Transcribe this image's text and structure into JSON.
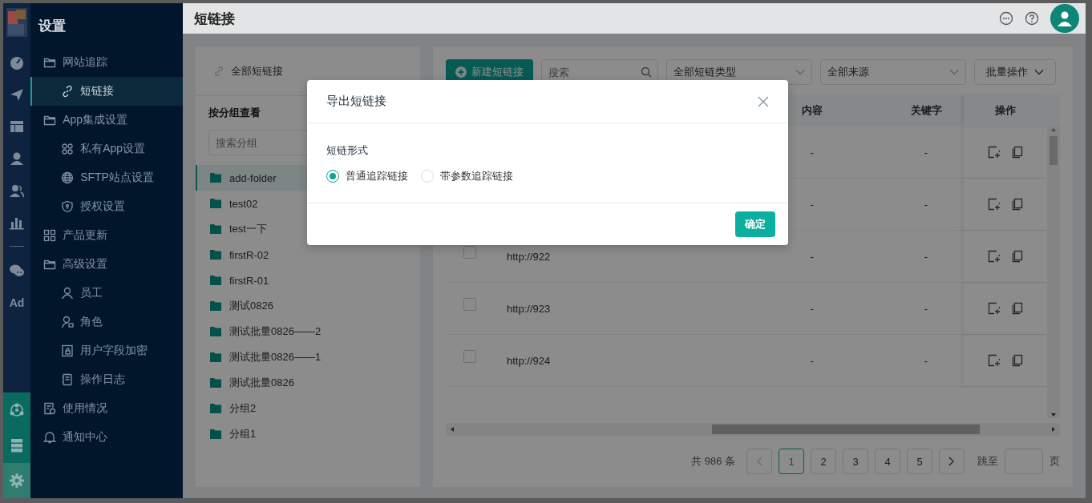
{
  "rail": {
    "items": [
      {
        "kind": "icon",
        "selected": false
      },
      {
        "kind": "icon",
        "selected": false
      },
      {
        "kind": "icon",
        "selected": false
      },
      {
        "kind": "icon",
        "selected": false
      },
      {
        "kind": "icon",
        "selected": false
      },
      {
        "kind": "icon",
        "selected": false
      },
      {
        "kind": "divider"
      },
      {
        "kind": "icon",
        "selected": false
      },
      {
        "kind": "text",
        "label": "Ad",
        "selected": false
      }
    ],
    "bottom_items": [
      {
        "selected": false
      },
      {
        "selected": false
      },
      {
        "selected": true
      }
    ]
  },
  "sidebar": {
    "title": "设置",
    "items": [
      {
        "label": "网站追踪",
        "selected": false,
        "children": [
          {
            "label": "短链接",
            "selected": true
          }
        ]
      },
      {
        "label": "App集成设置",
        "selected": false,
        "children": [
          {
            "label": "私有App设置",
            "selected": false
          },
          {
            "label": "SFTP站点设置",
            "selected": false
          },
          {
            "label": "授权设置",
            "selected": false
          }
        ]
      },
      {
        "label": "产品更新",
        "selected": false
      },
      {
        "label": "高级设置",
        "selected": false,
        "children": [
          {
            "label": "员工",
            "selected": false
          },
          {
            "label": "角色",
            "selected": false
          },
          {
            "label": "用户字段加密",
            "selected": false
          },
          {
            "label": "操作日志",
            "selected": false
          }
        ]
      },
      {
        "label": "使用情况",
        "selected": false
      },
      {
        "label": "通知中心",
        "selected": false
      }
    ]
  },
  "header": {
    "title": "短链接"
  },
  "groups": {
    "all_label": "全部短链接",
    "heading": "按分组查看",
    "search": {
      "placeholder": "搜索分组"
    },
    "items": [
      {
        "label": "add-folder",
        "selected": true
      },
      {
        "label": "test02",
        "selected": false
      },
      {
        "label": "test一下",
        "selected": false
      },
      {
        "label": "firstR-02",
        "selected": false
      },
      {
        "label": "firstR-01",
        "selected": false
      },
      {
        "label": "测试0826",
        "selected": false
      },
      {
        "label": "测试批量0826——2",
        "selected": false
      },
      {
        "label": "测试批量0826——1",
        "selected": false
      },
      {
        "label": "测试批量0826",
        "selected": false
      },
      {
        "label": "分组2",
        "selected": false
      },
      {
        "label": "分组1",
        "selected": false
      }
    ]
  },
  "toolbar": {
    "new_button": "新建短链接",
    "search": {
      "placeholder": "搜索"
    },
    "type_select": "全部短链类型",
    "source_select": "全部来源",
    "batch_button": "批量操作"
  },
  "table": {
    "columns": [
      {
        "label": "内容"
      },
      {
        "label": "关键字"
      },
      {
        "label": "操作"
      }
    ],
    "rows": [
      {
        "content": "-",
        "keyword": "-"
      },
      {
        "content": "-",
        "keyword": "-"
      },
      {
        "checked": false,
        "link": "http://922",
        "content": "-",
        "keyword": "-"
      },
      {
        "checked": false,
        "link": "http://923",
        "content": "-",
        "keyword": "-"
      },
      {
        "checked": false,
        "link": "http://924",
        "content": "-",
        "keyword": "-"
      }
    ]
  },
  "pagination": {
    "total": "共 986 条",
    "prev_disabled": true,
    "next_disabled": false,
    "pages": [
      {
        "label": "1",
        "selected": true
      },
      {
        "label": "2",
        "selected": false
      },
      {
        "label": "3",
        "selected": false
      },
      {
        "label": "4",
        "selected": false
      },
      {
        "label": "5",
        "selected": false
      }
    ],
    "jump_label": "跳至",
    "page_suffix": "页"
  },
  "dialog": {
    "title": "导出短链接",
    "field_label": "短链形式",
    "options": [
      {
        "label": "普通追踪链接",
        "selected": true
      },
      {
        "label": "带参数追踪链接",
        "selected": false
      }
    ],
    "confirm_button": "确定"
  }
}
